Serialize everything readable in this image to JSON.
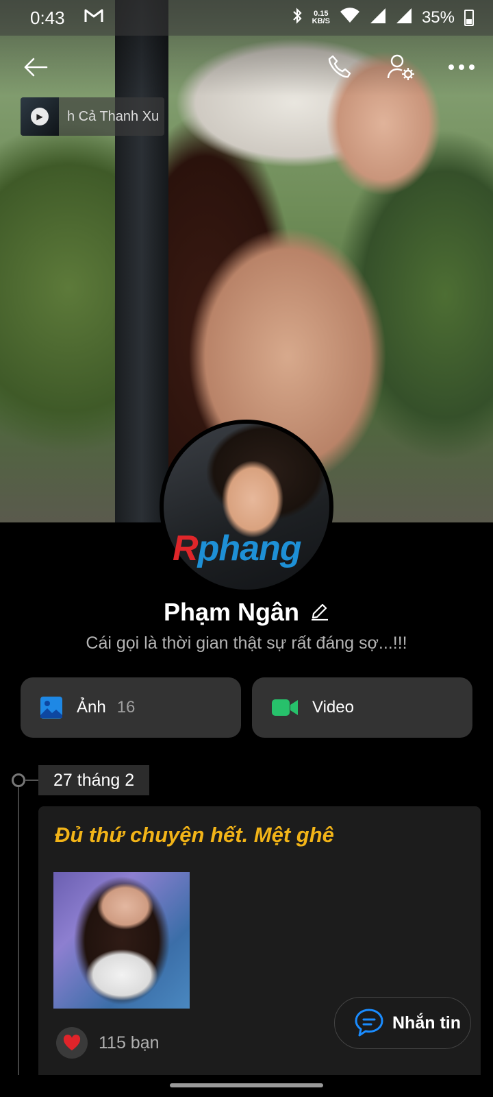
{
  "status_bar": {
    "time": "0:43",
    "net_speed_value": "0.15",
    "net_speed_unit": "KB/S",
    "battery_percent": "35%"
  },
  "music": {
    "title": "h Cả Thanh Xu"
  },
  "profile": {
    "name": "Phạm Ngân",
    "bio": "Cái gọi là thời gian thật sự rất đáng sợ...!!!"
  },
  "watermark": {
    "first": "R",
    "rest": "phang"
  },
  "media": {
    "photos_label": "Ảnh",
    "photos_count": "16",
    "video_label": "Video"
  },
  "timeline": {
    "date": "27 tháng 2",
    "post_text": "Đủ thứ chuyện hết. Mệt ghê",
    "likes": "115 bạn"
  },
  "message_button": {
    "label": "Nhắn tin"
  },
  "colors": {
    "accent_yellow": "#f2b418",
    "photo_icon_blue": "#1e88e5",
    "video_icon_green": "#27c16b",
    "message_icon_blue": "#1a8cff",
    "like_red": "#e0242a"
  }
}
